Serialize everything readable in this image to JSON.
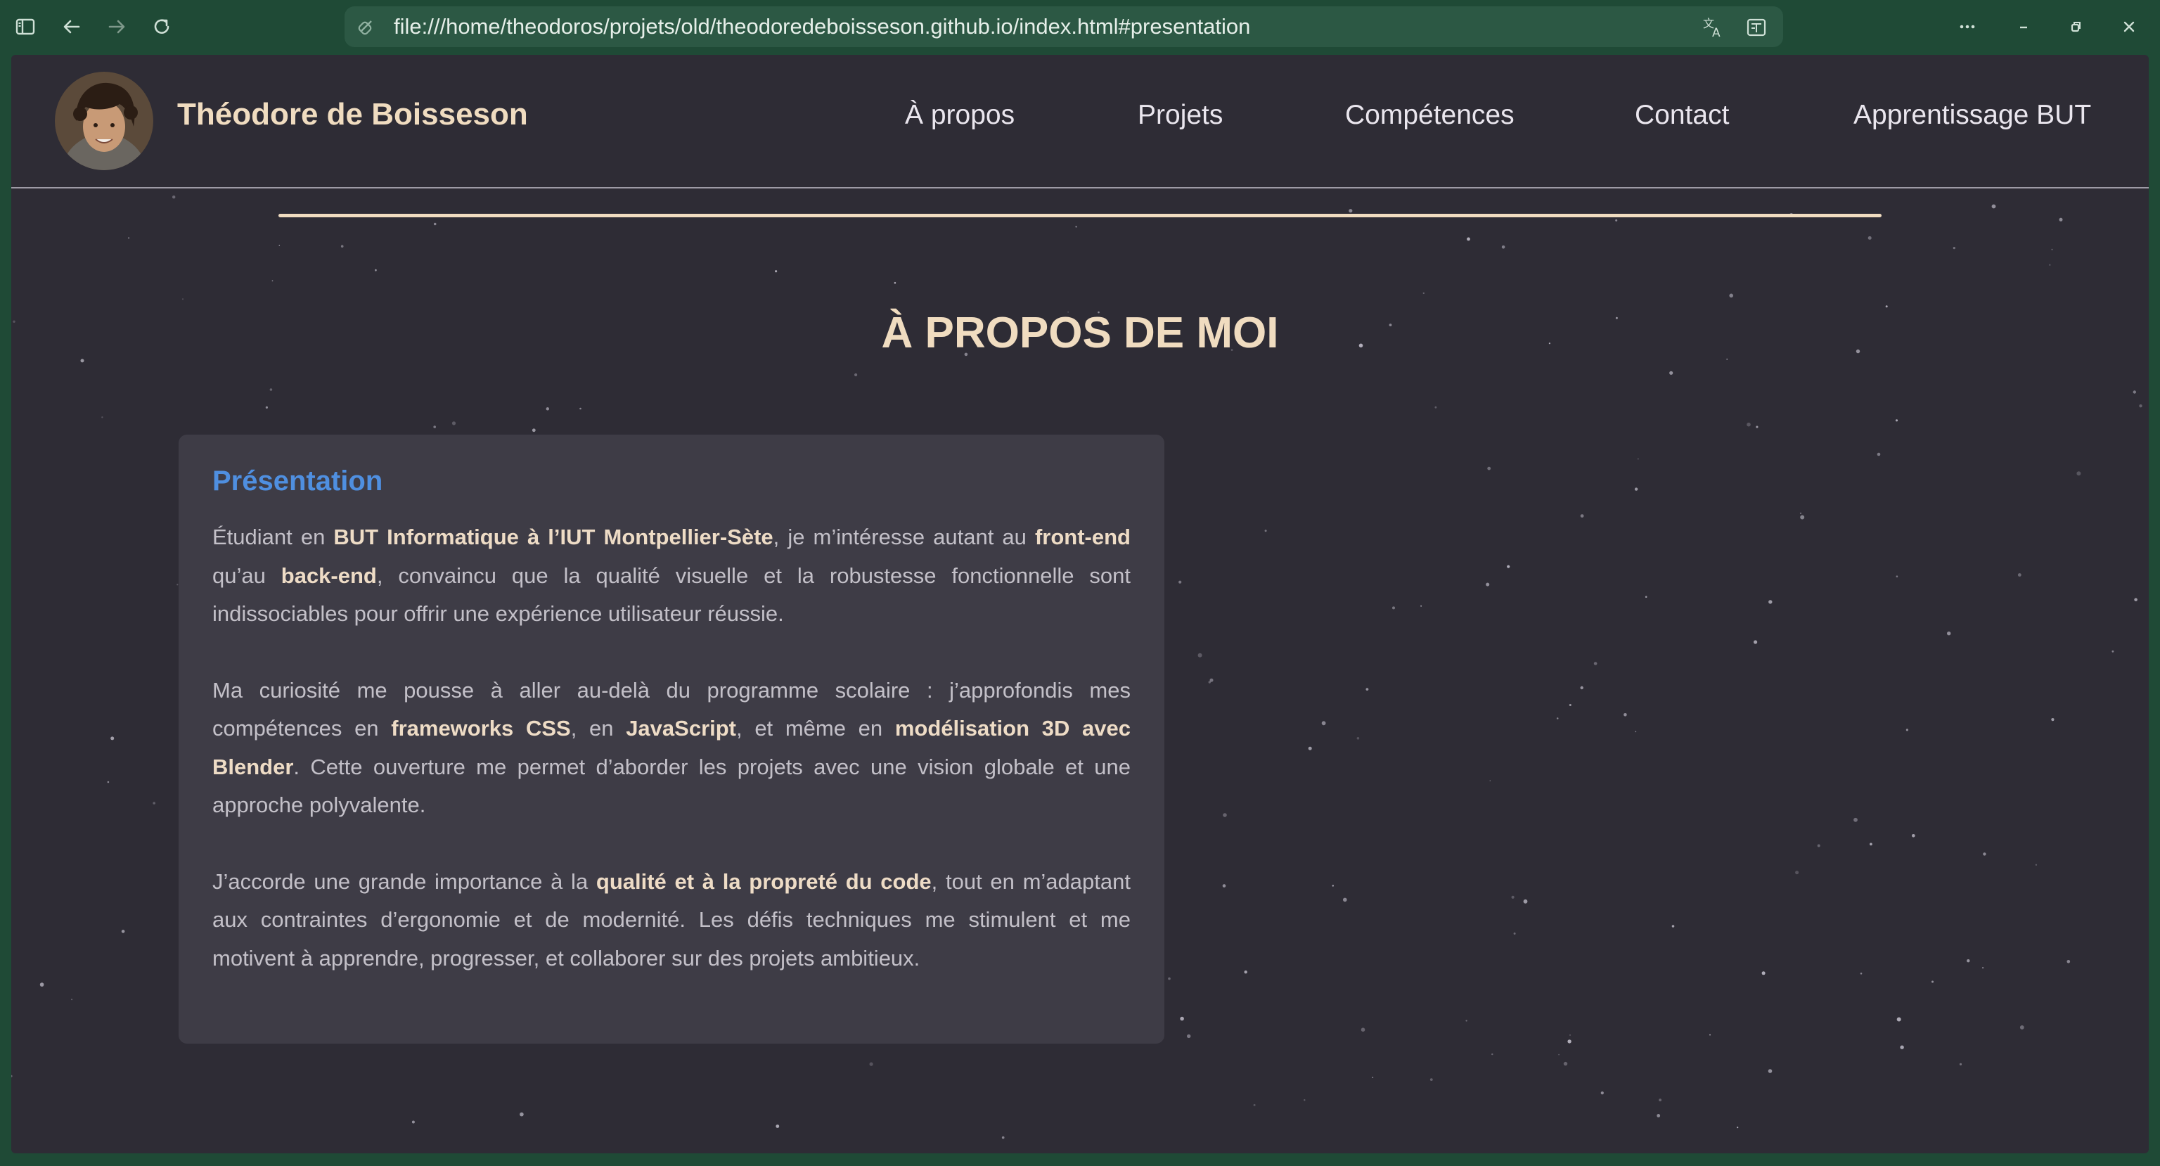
{
  "browser": {
    "url": "file:///home/theodoros/projets/old/theodoredeboisseson.github.io/index.html#presentation",
    "icons": [
      "sidebar-icon",
      "back-icon",
      "forward-icon",
      "reload-icon",
      "page-info-icon",
      "translate-icon",
      "reader-icon",
      "menu-icon",
      "minimize-icon",
      "restore-icon",
      "close-icon"
    ]
  },
  "header": {
    "site_name": "Théodore de Boisseson",
    "nav": [
      "À propos",
      "Projets",
      "Compétences",
      "Contact",
      "Apprentissage BUT"
    ]
  },
  "section": {
    "title": "À PROPOS DE MOI"
  },
  "card": {
    "title": "Présentation",
    "paragraphs": [
      [
        {
          "t": "Étudiant en "
        },
        {
          "t": "BUT Informatique à l’IUT Montpellier-Sète",
          "b": true
        },
        {
          "t": ", je m’intéresse autant au "
        },
        {
          "t": "front-end",
          "b": true
        },
        {
          "t": " qu’au "
        },
        {
          "t": "back-end",
          "b": true
        },
        {
          "t": ", convaincu que la qualité visuelle et la robustesse fonctionnelle sont indissociables pour offrir une expérience utilisateur réussie."
        }
      ],
      [
        {
          "t": "Ma curiosité me pousse à aller au-delà du programme scolaire : j’approfondis mes compétences en "
        },
        {
          "t": "frameworks CSS",
          "b": true
        },
        {
          "t": ", en "
        },
        {
          "t": "JavaScript",
          "b": true
        },
        {
          "t": ", et même en "
        },
        {
          "t": "modélisation 3D avec Blender",
          "b": true
        },
        {
          "t": ". Cette ouverture me permet d’aborder les projets avec une vision globale et une approche polyvalente."
        }
      ],
      [
        {
          "t": "J’accorde une grande importance à la "
        },
        {
          "t": "qualité et à la propreté du code",
          "b": true
        },
        {
          "t": ", tout en m’adaptant aux contraintes d’ergonomie et de modernité. Les défis techniques me stimulent et me motivent à apprendre, progresser, et collaborer sur des projets ambitieux."
        }
      ]
    ]
  },
  "colors": {
    "browser_chrome": "#1f4a36",
    "page_background": "#2e2c35",
    "accent_title": "#f0dcc0",
    "card_title": "#4f8fe0",
    "card_background": "#3e3c46"
  }
}
